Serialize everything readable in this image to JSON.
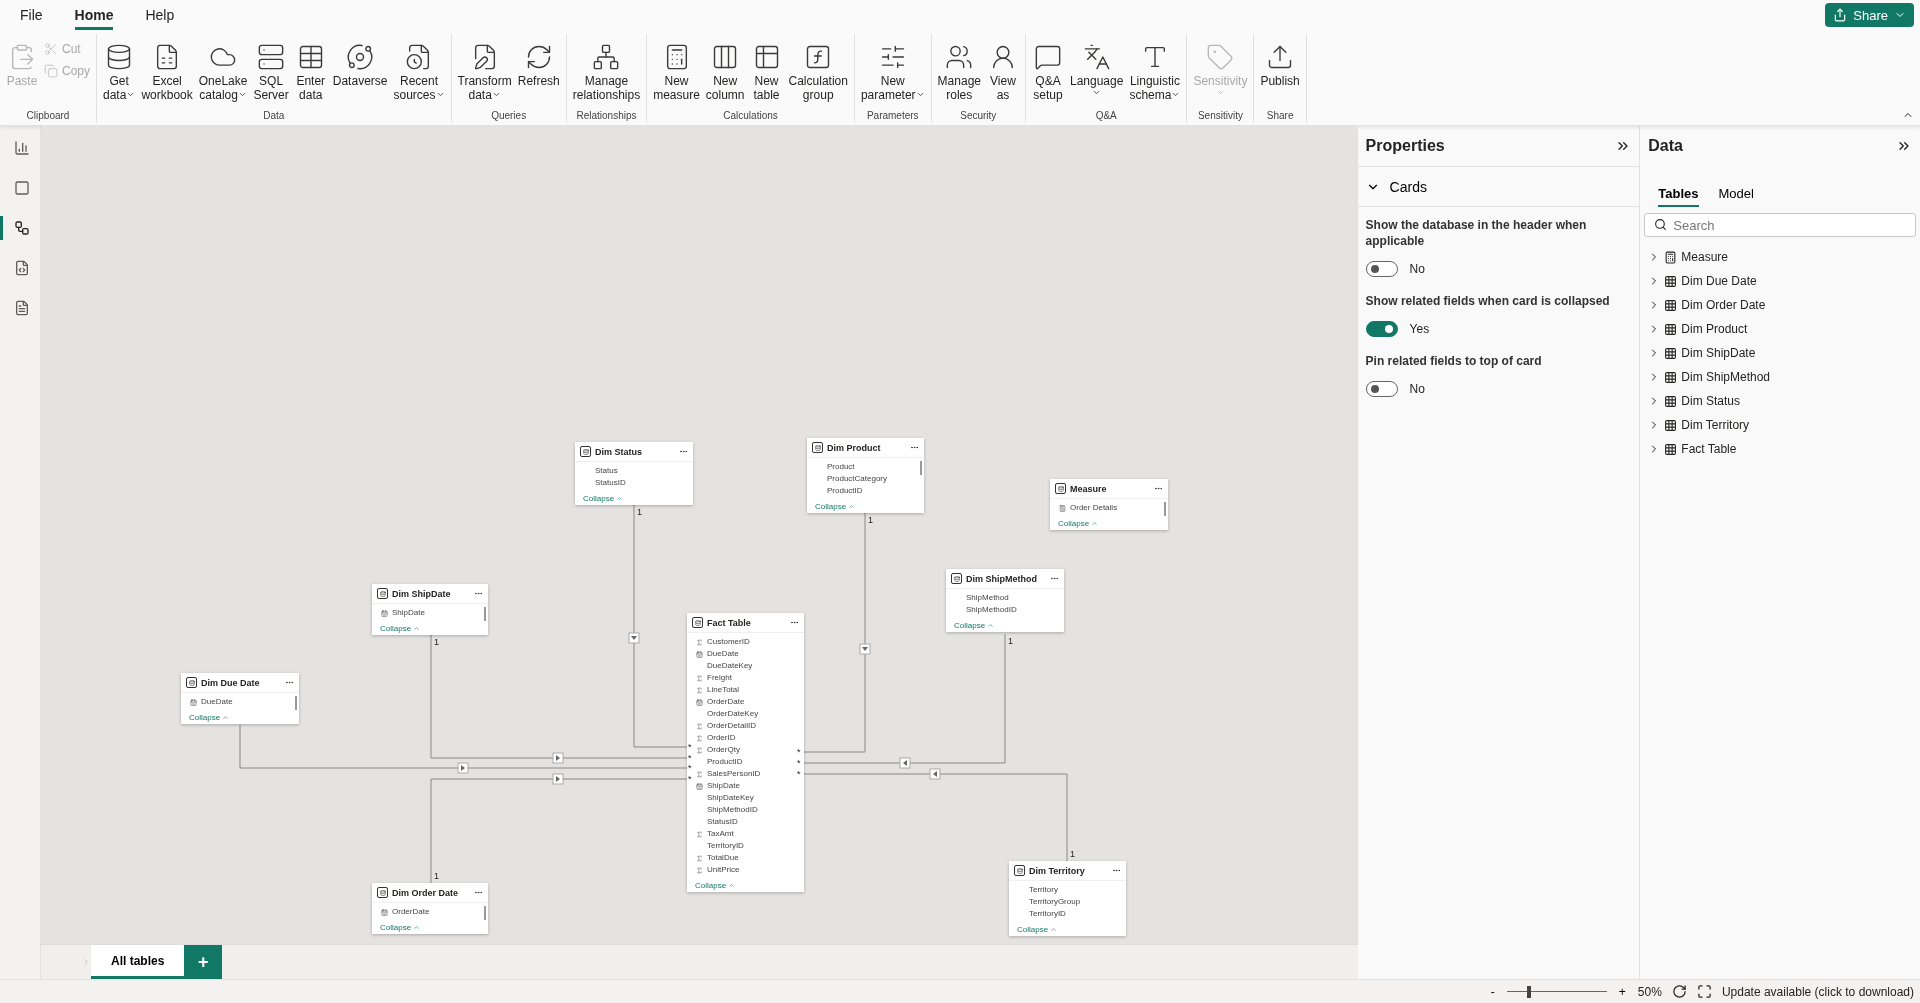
{
  "menu": [
    {
      "label": "File",
      "selected": false
    },
    {
      "label": "Home",
      "selected": true
    },
    {
      "label": "Help",
      "selected": false
    }
  ],
  "share": {
    "label": "Share"
  },
  "ribbon": [
    {
      "label": "Clipboard",
      "buttons": [
        {
          "lines": [
            "Paste"
          ],
          "disabled": true,
          "dropdown": false
        },
        {
          "lines": [
            "Cut"
          ],
          "disabled": true,
          "dropdown": false
        },
        {
          "lines": [
            "Copy"
          ],
          "disabled": true,
          "dropdown": false
        }
      ]
    },
    {
      "label": "Data",
      "buttons": [
        {
          "lines": [
            "Get",
            "data"
          ],
          "disabled": false,
          "dropdown": true
        },
        {
          "lines": [
            "Excel",
            "workbook"
          ],
          "disabled": false,
          "dropdown": false
        },
        {
          "lines": [
            "OneLake",
            "catalog"
          ],
          "disabled": false,
          "dropdown": true
        },
        {
          "lines": [
            "SQL",
            "Server"
          ],
          "disabled": false,
          "dropdown": false
        },
        {
          "lines": [
            "Enter",
            "data"
          ],
          "disabled": false,
          "dropdown": false
        },
        {
          "lines": [
            "Dataverse"
          ],
          "disabled": false,
          "dropdown": false
        },
        {
          "lines": [
            "Recent",
            "sources"
          ],
          "disabled": false,
          "dropdown": true
        }
      ]
    },
    {
      "label": "Queries",
      "buttons": [
        {
          "lines": [
            "Transform",
            "data"
          ],
          "disabled": false,
          "dropdown": true
        },
        {
          "lines": [
            "Refresh"
          ],
          "disabled": false,
          "dropdown": false
        }
      ]
    },
    {
      "label": "Relationships",
      "buttons": [
        {
          "lines": [
            "Manage",
            "relationships"
          ],
          "disabled": false,
          "dropdown": false
        }
      ]
    },
    {
      "label": "Calculations",
      "buttons": [
        {
          "lines": [
            "New",
            "measure"
          ],
          "disabled": false,
          "dropdown": false
        },
        {
          "lines": [
            "New",
            "column"
          ],
          "disabled": false,
          "dropdown": false
        },
        {
          "lines": [
            "New",
            "table"
          ],
          "disabled": false,
          "dropdown": false
        },
        {
          "lines": [
            "Calculation",
            "group"
          ],
          "disabled": false,
          "dropdown": false
        }
      ]
    },
    {
      "label": "Parameters",
      "buttons": [
        {
          "lines": [
            "New",
            "parameter"
          ],
          "disabled": false,
          "dropdown": true
        }
      ]
    },
    {
      "label": "Security",
      "buttons": [
        {
          "lines": [
            "Manage",
            "roles"
          ],
          "disabled": false,
          "dropdown": false
        },
        {
          "lines": [
            "View",
            "as"
          ],
          "disabled": false,
          "dropdown": false
        }
      ]
    },
    {
      "label": "Q&A",
      "buttons": [
        {
          "lines": [
            "Q&A",
            "setup"
          ],
          "disabled": false,
          "dropdown": false
        },
        {
          "lines": [
            "Language"
          ],
          "disabled": false,
          "dropdown": true
        },
        {
          "lines": [
            "Linguistic",
            "schema"
          ],
          "disabled": false,
          "dropdown": true
        }
      ]
    },
    {
      "label": "Sensitivity",
      "buttons": [
        {
          "lines": [
            "Sensitivity"
          ],
          "disabled": true,
          "dropdown": true
        }
      ]
    },
    {
      "label": "Share",
      "buttons": [
        {
          "lines": [
            "Publish"
          ],
          "disabled": false,
          "dropdown": false
        }
      ]
    }
  ],
  "views": [
    {
      "selected": false
    },
    {
      "selected": false
    },
    {
      "selected": true
    },
    {
      "selected": false
    },
    {
      "selected": false
    }
  ],
  "canvas": {
    "cards": [
      {
        "name": "Dim Status",
        "fields": [
          {
            "name": "Status",
            "kind": "plain"
          },
          {
            "name": "StatusID",
            "kind": "plain"
          }
        ],
        "footer": "Collapse"
      },
      {
        "name": "Dim Product",
        "fields": [
          {
            "name": "Product",
            "kind": "plain"
          },
          {
            "name": "ProductCategory",
            "kind": "plain"
          },
          {
            "name": "ProductID",
            "kind": "plain"
          }
        ],
        "footer": "Collapse"
      },
      {
        "name": "Measure",
        "fields": [
          {
            "name": "Order Details",
            "kind": "measure"
          }
        ],
        "footer": "Collapse"
      },
      {
        "name": "Dim ShipDate",
        "fields": [
          {
            "name": "ShipDate",
            "kind": "date"
          }
        ],
        "footer": "Collapse"
      },
      {
        "name": "Dim ShipMethod",
        "fields": [
          {
            "name": "ShipMethod",
            "kind": "plain"
          },
          {
            "name": "ShipMethodID",
            "kind": "plain"
          }
        ],
        "footer": "Collapse"
      },
      {
        "name": "Fact Table",
        "fields": [
          {
            "name": "CustomerID",
            "kind": "sum"
          },
          {
            "name": "DueDate",
            "kind": "date"
          },
          {
            "name": "DueDateKey",
            "kind": "plain"
          },
          {
            "name": "Freight",
            "kind": "sum"
          },
          {
            "name": "LineTotal",
            "kind": "sum"
          },
          {
            "name": "OrderDate",
            "kind": "date"
          },
          {
            "name": "OrderDateKey",
            "kind": "plain"
          },
          {
            "name": "OrderDetailID",
            "kind": "sum"
          },
          {
            "name": "OrderID",
            "kind": "sum"
          },
          {
            "name": "OrderQty",
            "kind": "sum"
          },
          {
            "name": "ProductID",
            "kind": "plain"
          },
          {
            "name": "SalesPersonID",
            "kind": "sum"
          },
          {
            "name": "ShipDate",
            "kind": "date"
          },
          {
            "name": "ShipDateKey",
            "kind": "plain"
          },
          {
            "name": "ShipMethodID",
            "kind": "plain"
          },
          {
            "name": "StatusID",
            "kind": "plain"
          },
          {
            "name": "TaxAmt",
            "kind": "sum"
          },
          {
            "name": "TerritoryID",
            "kind": "plain"
          },
          {
            "name": "TotalDue",
            "kind": "sum"
          },
          {
            "name": "UnitPrice",
            "kind": "sum"
          }
        ],
        "footer": "Collapse"
      },
      {
        "name": "Dim Due Date",
        "fields": [
          {
            "name": "DueDate",
            "kind": "date"
          }
        ],
        "footer": "Collapse"
      },
      {
        "name": "Dim Order Date",
        "fields": [
          {
            "name": "OrderDate",
            "kind": "date"
          }
        ],
        "footer": "Collapse"
      },
      {
        "name": "Dim Territory",
        "fields": [
          {
            "name": "Territory",
            "kind": "plain"
          },
          {
            "name": "TerritoryGroup",
            "kind": "plain"
          },
          {
            "name": "TerritoryID",
            "kind": "plain"
          }
        ],
        "footer": "Collapse"
      }
    ],
    "relationships": [
      {
        "one": "1",
        "many": "*"
      },
      {
        "one": "1",
        "many": "*"
      },
      {
        "one": "1",
        "many": "*"
      },
      {
        "many": "*"
      },
      {
        "one": "1",
        "many": "*"
      },
      {
        "one": "1",
        "many": "*"
      },
      {
        "one": "1",
        "many": "*"
      }
    ]
  },
  "page_tabs": [
    {
      "label": "All tables",
      "selected": true
    }
  ],
  "add_page": "+",
  "properties": {
    "title": "Properties",
    "section": {
      "label": "Cards",
      "expanded": true
    },
    "settings": [
      {
        "label": "Show the database in the header when applicable",
        "on": false,
        "value": "No"
      },
      {
        "label": "Show related fields when card is collapsed",
        "on": true,
        "value": "Yes"
      },
      {
        "label": "Pin related fields to top of card",
        "on": false,
        "value": "No"
      }
    ]
  },
  "data_pane": {
    "title": "Data",
    "tabs": [
      {
        "label": "Tables",
        "selected": true
      },
      {
        "label": "Model",
        "selected": false
      }
    ],
    "search": {
      "placeholder": "Search"
    },
    "tables": [
      {
        "name": "Measure",
        "kind": "measure",
        "expanded": false
      },
      {
        "name": "Dim Due Date",
        "kind": "table",
        "expanded": false
      },
      {
        "name": "Dim Order Date",
        "kind": "table",
        "expanded": false
      },
      {
        "name": "Dim Product",
        "kind": "table",
        "expanded": false
      },
      {
        "name": "Dim ShipDate",
        "kind": "table",
        "expanded": false
      },
      {
        "name": "Dim ShipMethod",
        "kind": "table",
        "expanded": false
      },
      {
        "name": "Dim Status",
        "kind": "table",
        "expanded": false
      },
      {
        "name": "Dim Territory",
        "kind": "table",
        "expanded": false
      },
      {
        "name": "Fact Table",
        "kind": "table",
        "expanded": false
      }
    ]
  },
  "status_bar": {
    "zoom_out": "-",
    "zoom": {
      "level": 0.22
    },
    "zoom_in": "+",
    "zoom_text": "50%",
    "update": "Update available (click to download)"
  }
}
